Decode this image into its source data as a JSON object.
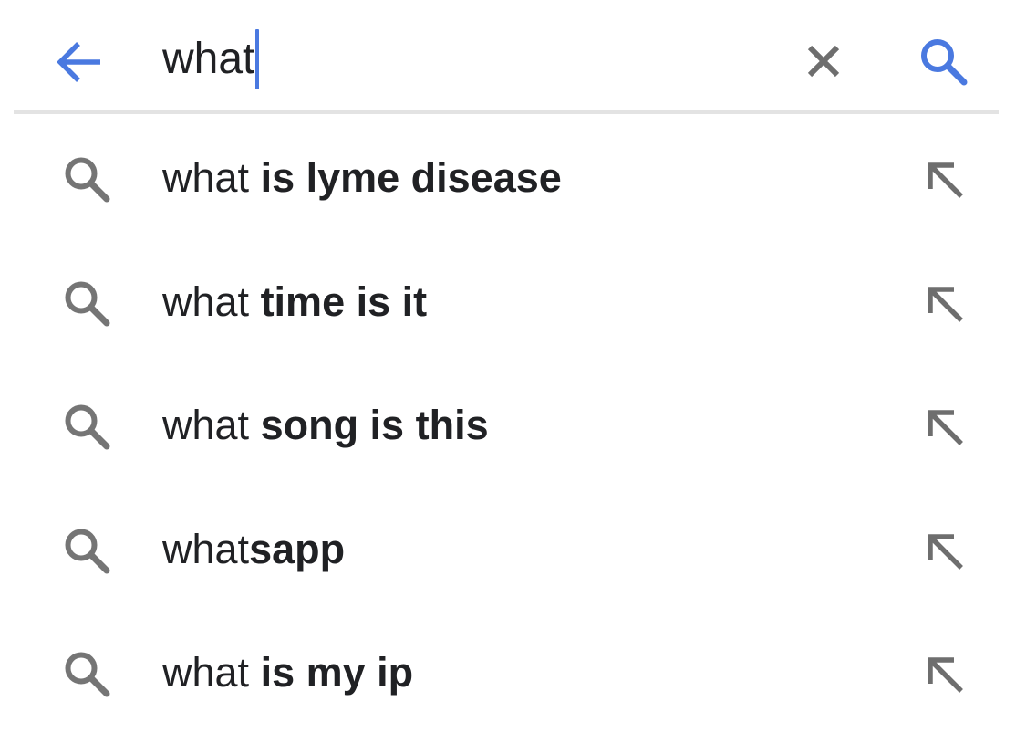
{
  "search_bar": {
    "query": "what",
    "back_icon": "arrow-left-icon",
    "clear_icon": "close-icon",
    "search_icon": "search-icon",
    "accent_color": "#4a79e0"
  },
  "suggestions": [
    {
      "prefix": "what",
      "completion": " is lyme disease",
      "icon": "search-icon",
      "action_icon": "arrow-up-left-icon"
    },
    {
      "prefix": "what",
      "completion": " time is it",
      "icon": "search-icon",
      "action_icon": "arrow-up-left-icon"
    },
    {
      "prefix": "what",
      "completion": " song is this",
      "icon": "search-icon",
      "action_icon": "arrow-up-left-icon"
    },
    {
      "prefix": "what",
      "completion": "sapp",
      "icon": "search-icon",
      "action_icon": "arrow-up-left-icon"
    },
    {
      "prefix": "what",
      "completion": " is my ip",
      "icon": "search-icon",
      "action_icon": "arrow-up-left-icon"
    }
  ]
}
